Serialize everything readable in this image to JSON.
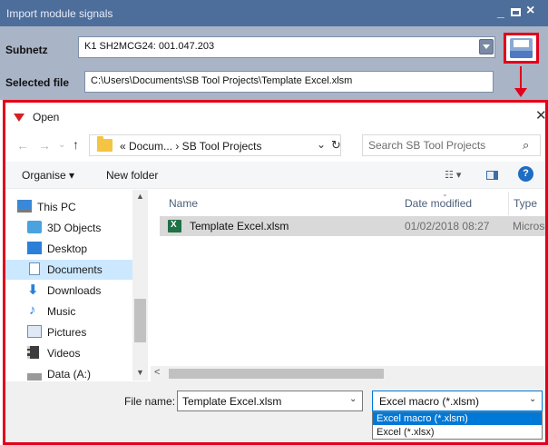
{
  "bg_window": {
    "title": "Import module signals",
    "subnetz_label": "Subnetz",
    "subnetz_value": "K1 SH2MCG24: 001.047.203",
    "selected_file_label": "Selected file",
    "selected_file_value": "C:\\Users\\Documents\\SB Tool Projects\\Template Excel.xlsm",
    "accent_color": "#e2001a"
  },
  "dialog": {
    "title": "Open",
    "close": "✕",
    "nav": {
      "back": "←",
      "forward": "→",
      "recent": "⌄",
      "up": "↑"
    },
    "address": {
      "path": "« Docum...  ›  SB Tool Projects",
      "chevron": "⌄",
      "refresh": "↻"
    },
    "search": {
      "placeholder": "Search SB Tool Projects",
      "icon": "⌕"
    },
    "toolbar": {
      "organise": "Organise ▾",
      "new_folder": "New folder",
      "view": "☷ ▾",
      "help": "?"
    },
    "nav_pane": {
      "items": [
        {
          "label": "This PC",
          "icon": "pc-icon"
        },
        {
          "label": "3D Objects",
          "icon": "cube-icon"
        },
        {
          "label": "Desktop",
          "icon": "desktop-icon"
        },
        {
          "label": "Documents",
          "icon": "documents-icon",
          "selected": true
        },
        {
          "label": "Downloads",
          "icon": "download-arrow-icon"
        },
        {
          "label": "Music",
          "icon": "music-note-icon"
        },
        {
          "label": "Pictures",
          "icon": "pictures-icon"
        },
        {
          "label": "Videos",
          "icon": "film-icon"
        },
        {
          "label": "Data (A:)",
          "icon": "drive-icon"
        }
      ],
      "scroll_up": "▲",
      "scroll_down": "▼"
    },
    "file_list": {
      "columns": {
        "name": "Name",
        "date": "Date modified",
        "type": "Type"
      },
      "sort_indicator": "⌄",
      "rows": [
        {
          "name": "Template Excel.xlsm",
          "date": "01/02/2018 08:27",
          "type": "Microsoft"
        }
      ],
      "scroll_left": "<"
    },
    "bottom": {
      "file_name_label": "File name:",
      "file_name_value": "Template Excel.xlsm",
      "file_type_value": "Excel macro (*.xlsm)",
      "chevron": "⌄",
      "file_type_options": [
        "Excel macro (*.xlsm)",
        "Excel (*.xlsx)"
      ]
    }
  }
}
